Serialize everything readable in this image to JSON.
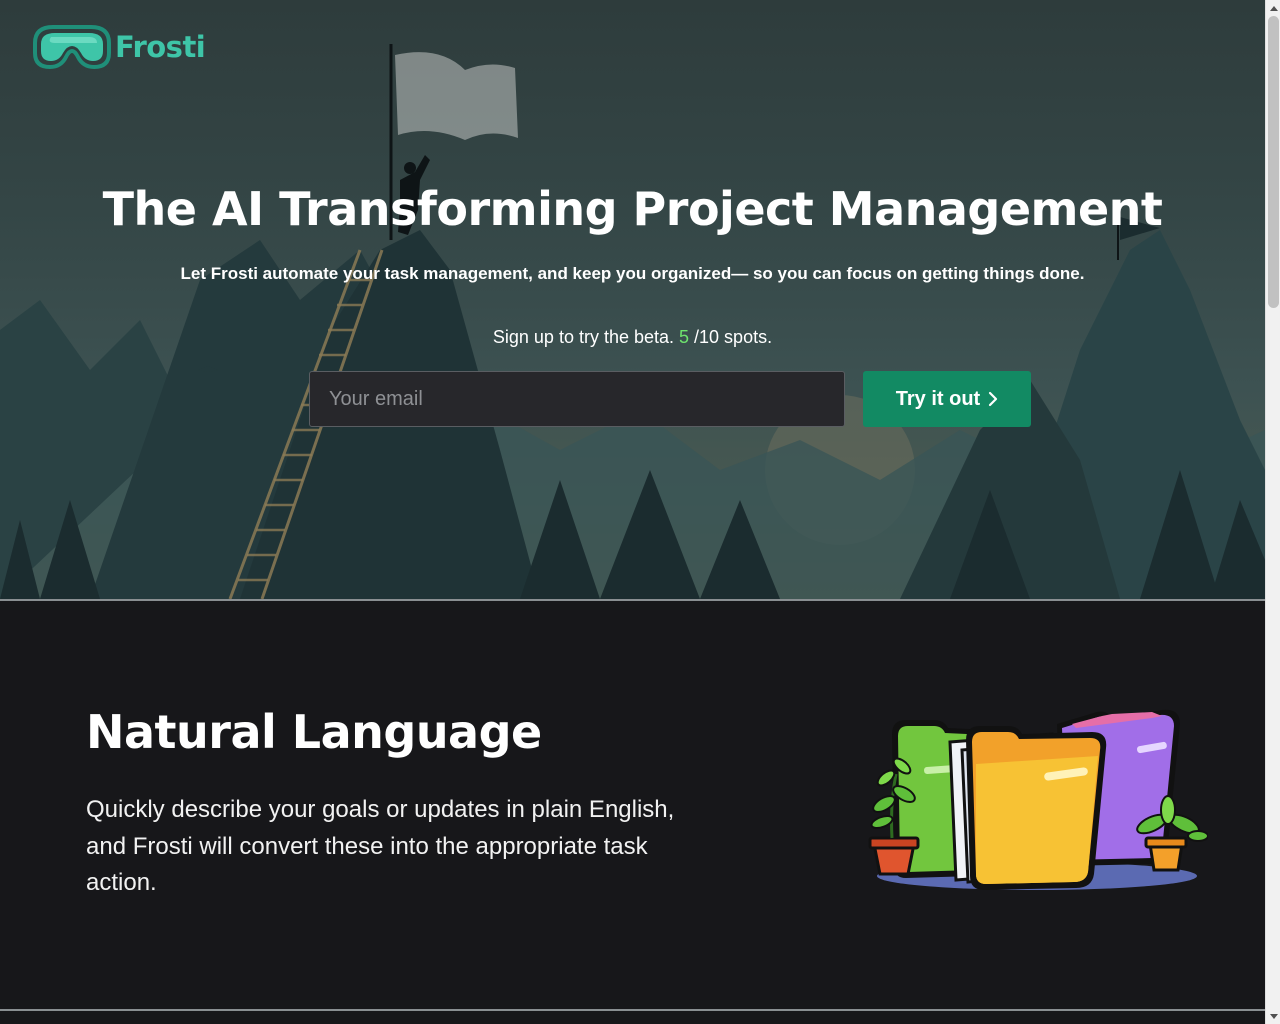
{
  "brand": {
    "name": "Frosti",
    "accent": "#3ec5a8"
  },
  "hero": {
    "title": "The AI Transforming Project Management",
    "subtitle": "Let Frosti automate your task management, and keep you organized— so you can focus on getting things done.",
    "beta_prefix": "Sign up to try the beta. ",
    "beta_count": "5",
    "beta_suffix": " /10 spots.",
    "beta_count_color": "#6ee36e"
  },
  "signup": {
    "email_placeholder": "Your email",
    "button_label": "Try it out",
    "button_color": "#128a63"
  },
  "feature": {
    "title": "Natural Language",
    "description": "Quickly describe your goals or updates in plain English, and Frosti will convert these into the appropriate task action."
  },
  "icons": {
    "logo": "goggles-logo-icon",
    "button": "chevron-right-icon",
    "hero_art": "mountain-ladder-illustration",
    "feature_art": "folders-plants-illustration"
  }
}
